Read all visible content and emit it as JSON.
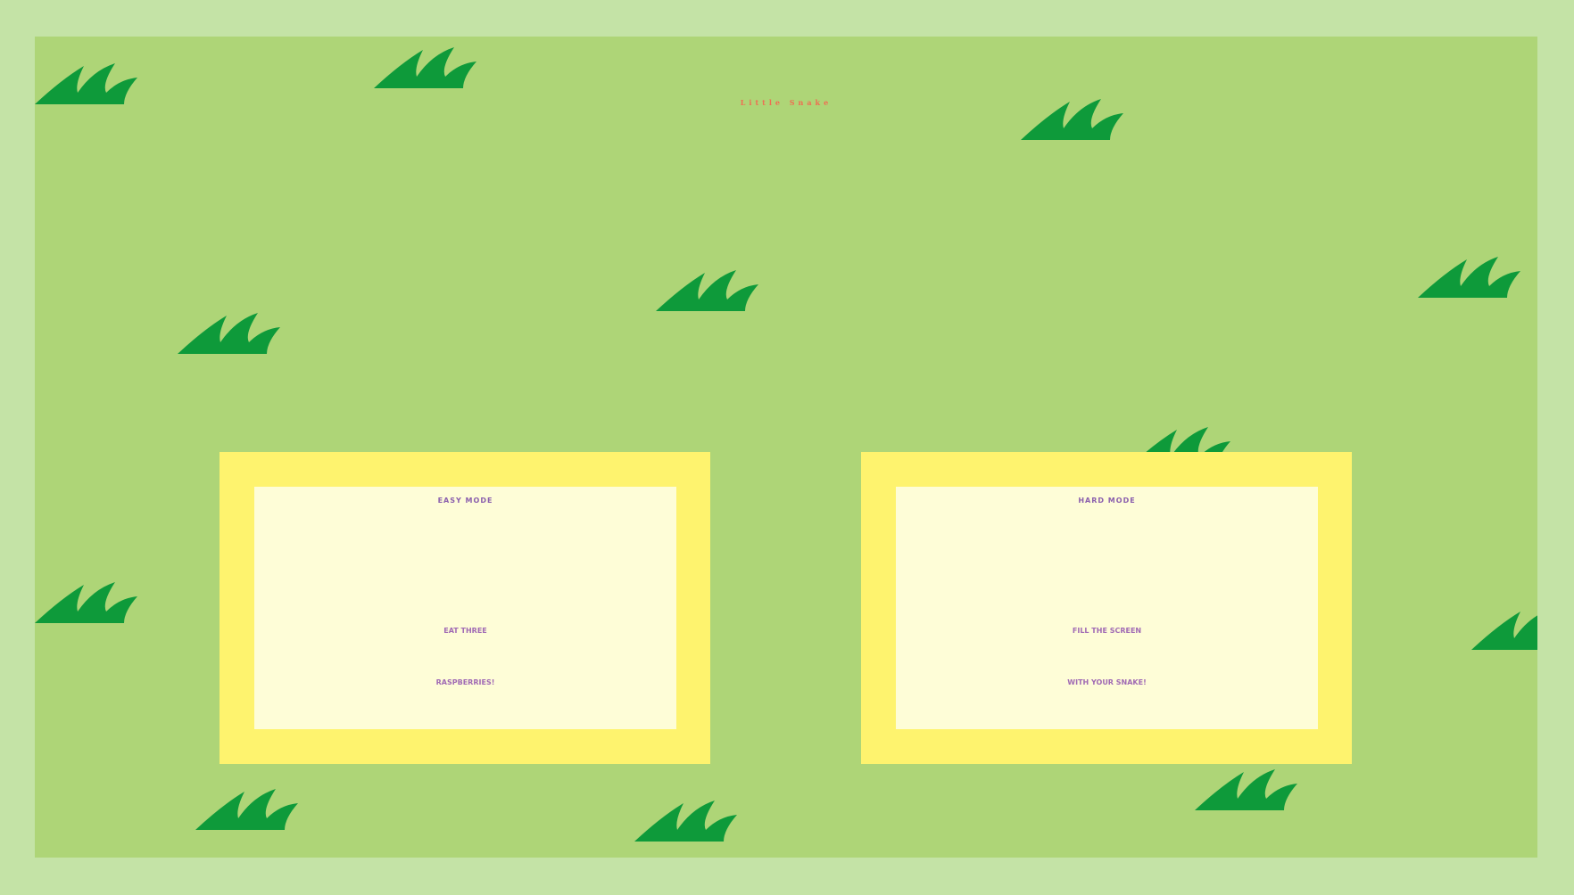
{
  "game": {
    "title": "Little Snake"
  },
  "modes": [
    {
      "title": "EASY MODE",
      "desc_line1": "EAT THREE",
      "desc_line2": "RASPBERRIES!"
    },
    {
      "title": "HARD MODE",
      "desc_line1": "FILL THE SCREEN",
      "desc_line2": "WITH YOUR SNAKE!"
    }
  ],
  "colors": {
    "outer_border": "#c4e3a6",
    "field": "#aed577",
    "grass": "#0e9a3a",
    "title": "#f06d52",
    "card_border": "#fef36e",
    "card_fill": "#fefdd7",
    "card_title": "#8a5fad",
    "card_text": "#a06ab4"
  },
  "icons": [
    "grass-tuft-icon"
  ]
}
